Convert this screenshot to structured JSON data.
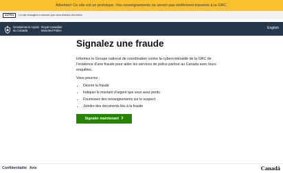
{
  "banner": {
    "text": "Attention! Ce site est un prototype. Vos renseignements ne seront pas réellement transmis à la GRC.",
    "color": "#fbc02d"
  },
  "phase": {
    "tag": "ALPHA",
    "text": "Le site changera à mesure que nous testons des idées"
  },
  "header": {
    "org_fr": [
      "Gendarmerie royale",
      "du Canada"
    ],
    "org_en": [
      "Royal Canadian",
      "Mounted Police"
    ],
    "language_link": "English",
    "background": "#26374a"
  },
  "main": {
    "title": "Signalez une fraude",
    "intro": "Informez le Groupe national de coordination contre la cybercriminalité de la GRC de l’incidence d’une fraude pour aider les services de police partout au Canada avec leurs enquêtes.",
    "you_can": "Vous pourrez :",
    "tasks": [
      "Décrire la fraude",
      "Indiquer le montant d’argent que vous avez perdu",
      "Fournissez des renseignements sur le suspect",
      "Joindre des documents liés à la fraude"
    ],
    "start_button": "Signaler maintenant",
    "start_button_icon": "chevron-right-icon",
    "button_color": "#278400"
  },
  "footer": {
    "links": [
      "Confidentialité",
      "Avis"
    ],
    "wordmark": "Canadä"
  }
}
